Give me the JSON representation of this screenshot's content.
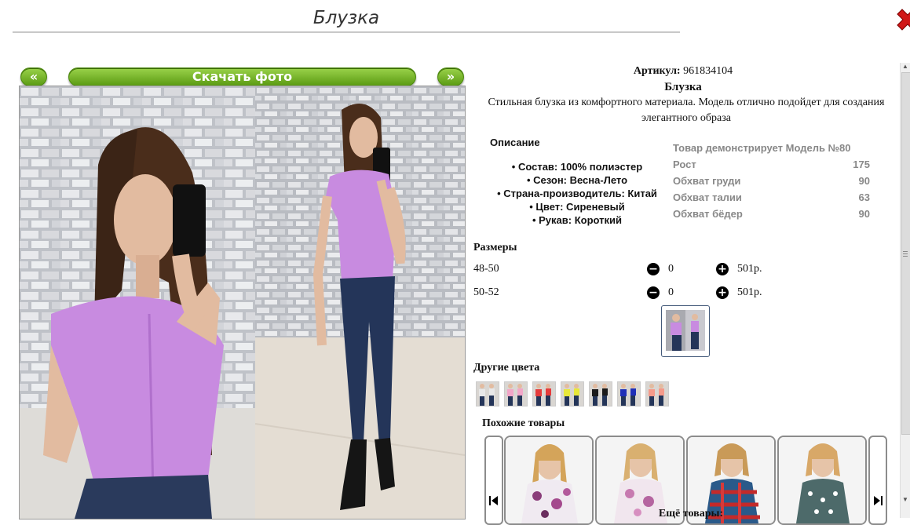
{
  "window": {
    "title": "Блузка"
  },
  "gallery": {
    "prev_label": "«",
    "next_label": "»",
    "download_label": "Скачать фото"
  },
  "product": {
    "article_label": "Артикул:",
    "article_value": "961834104",
    "name": "Блузка",
    "tagline": "Стильная блузка из комфортного материала. Модель отлично подойдет для создания элегантного образа"
  },
  "description": {
    "heading": "Описание",
    "items": [
      "Состав: 100% полиэстер",
      "Сезон: Весна-Лето",
      "Страна-производитель: Китай",
      "Цвет: Сиреневый",
      "Рукав: Короткий"
    ]
  },
  "model": {
    "heading": "Товар демонстрирует Модель №80",
    "rows": [
      {
        "label": "Рост",
        "value": "175"
      },
      {
        "label": "Обхват груди",
        "value": "90"
      },
      {
        "label": "Обхват талии",
        "value": "63"
      },
      {
        "label": "Обхват бёдер",
        "value": "90"
      }
    ]
  },
  "sizes": {
    "heading": "Размеры",
    "rows": [
      {
        "size": "48-50",
        "qty": "0",
        "price": "501р."
      },
      {
        "size": "50-52",
        "qty": "0",
        "price": "501р."
      }
    ]
  },
  "colors": {
    "heading": "Другие цвета",
    "swatches": [
      "#e8e8e8",
      "#f2a6c8",
      "#e53c3c",
      "#e8e83a",
      "#1a1a1a",
      "#1f2fb8",
      "#f59a8a"
    ]
  },
  "similar": {
    "heading": "Похожие товары",
    "more_label": "Ещё товары:"
  },
  "icons": {
    "close": "close-icon",
    "minus": "minus-icon",
    "plus": "plus-icon",
    "first": "first-icon",
    "last": "last-icon"
  },
  "accent": "#6aa81c"
}
